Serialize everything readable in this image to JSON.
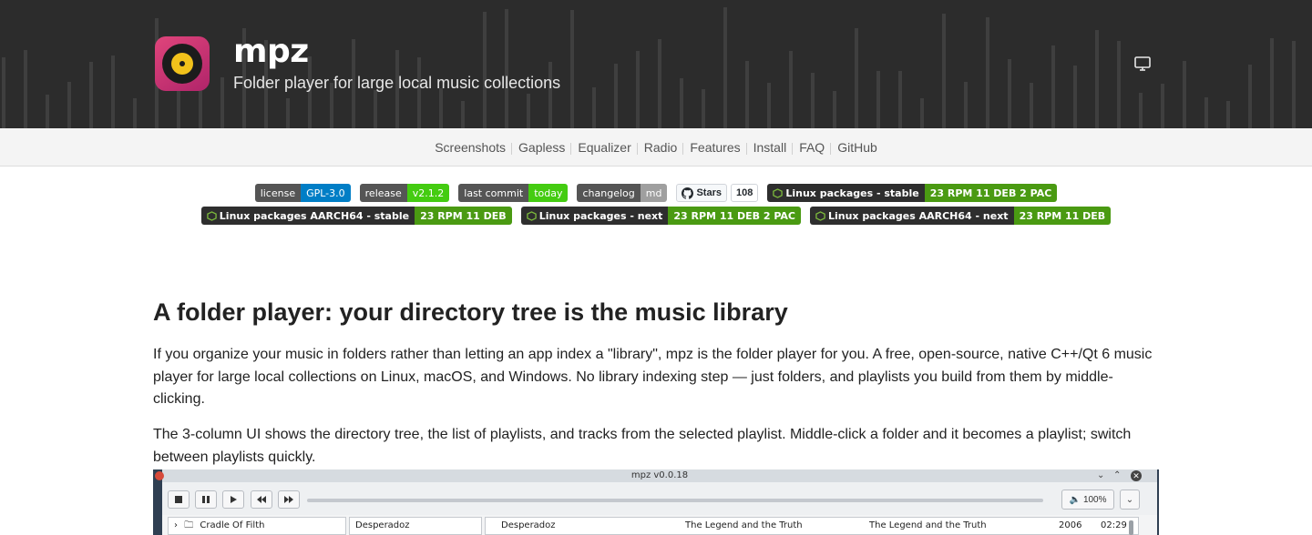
{
  "header": {
    "app_name": "mpz",
    "tagline": "Folder player for large local music collections",
    "theme_toggle_icon": "monitor-icon"
  },
  "nav": {
    "links": [
      "Screenshots",
      "Gapless",
      "Equalizer",
      "Radio",
      "Features",
      "Install",
      "FAQ",
      "GitHub"
    ]
  },
  "badges": {
    "license": {
      "label": "license",
      "value": "GPL-3.0",
      "color": "#007ec6"
    },
    "release": {
      "label": "release",
      "value": "v2.1.2",
      "color": "#44cc11"
    },
    "commit": {
      "label": "last commit",
      "value": "today",
      "color": "#44cc11"
    },
    "changelog": {
      "label": "changelog",
      "value": "md",
      "color": "#9f9f9f"
    },
    "stars": {
      "label": "Stars",
      "value": "108"
    },
    "pkg_stable": {
      "label": "Linux packages - stable",
      "value": "23 RPM 11 DEB 2 PAC"
    },
    "pkg_aarch_stable": {
      "label": "Linux packages AARCH64 - stable",
      "value": "23 RPM 11 DEB"
    },
    "pkg_next": {
      "label": "Linux packages - next",
      "value": "23 RPM 11 DEB 2 PAC"
    },
    "pkg_aarch_next": {
      "label": "Linux packages AARCH64 - next",
      "value": "23 RPM 11 DEB"
    }
  },
  "content": {
    "heading": "A folder player: your directory tree is the music library",
    "para1": "If you organize your music in folders rather than letting an app index a \"library\", mpz is the folder player for you. A free, open-source, native C++/Qt 6 music player for large local collections on Linux, macOS, and Windows. No library indexing step — just folders, and playlists you build from them by middle-clicking.",
    "para2": "The 3-column UI shows the directory tree, the list of playlists, and tracks from the selected playlist. Middle-click a folder and it becomes a playlist; switch between playlists quickly."
  },
  "screenshot": {
    "window_title": "mpz v0.0.18",
    "volume": "100%",
    "tree_item": "Cradle Of Filth",
    "playlist_item": "Desperadoz",
    "track": {
      "title": "Desperadoz",
      "artist": "The Legend and the Truth",
      "album": "The Legend and the Truth",
      "year": "2006",
      "duration": "02:29"
    }
  }
}
